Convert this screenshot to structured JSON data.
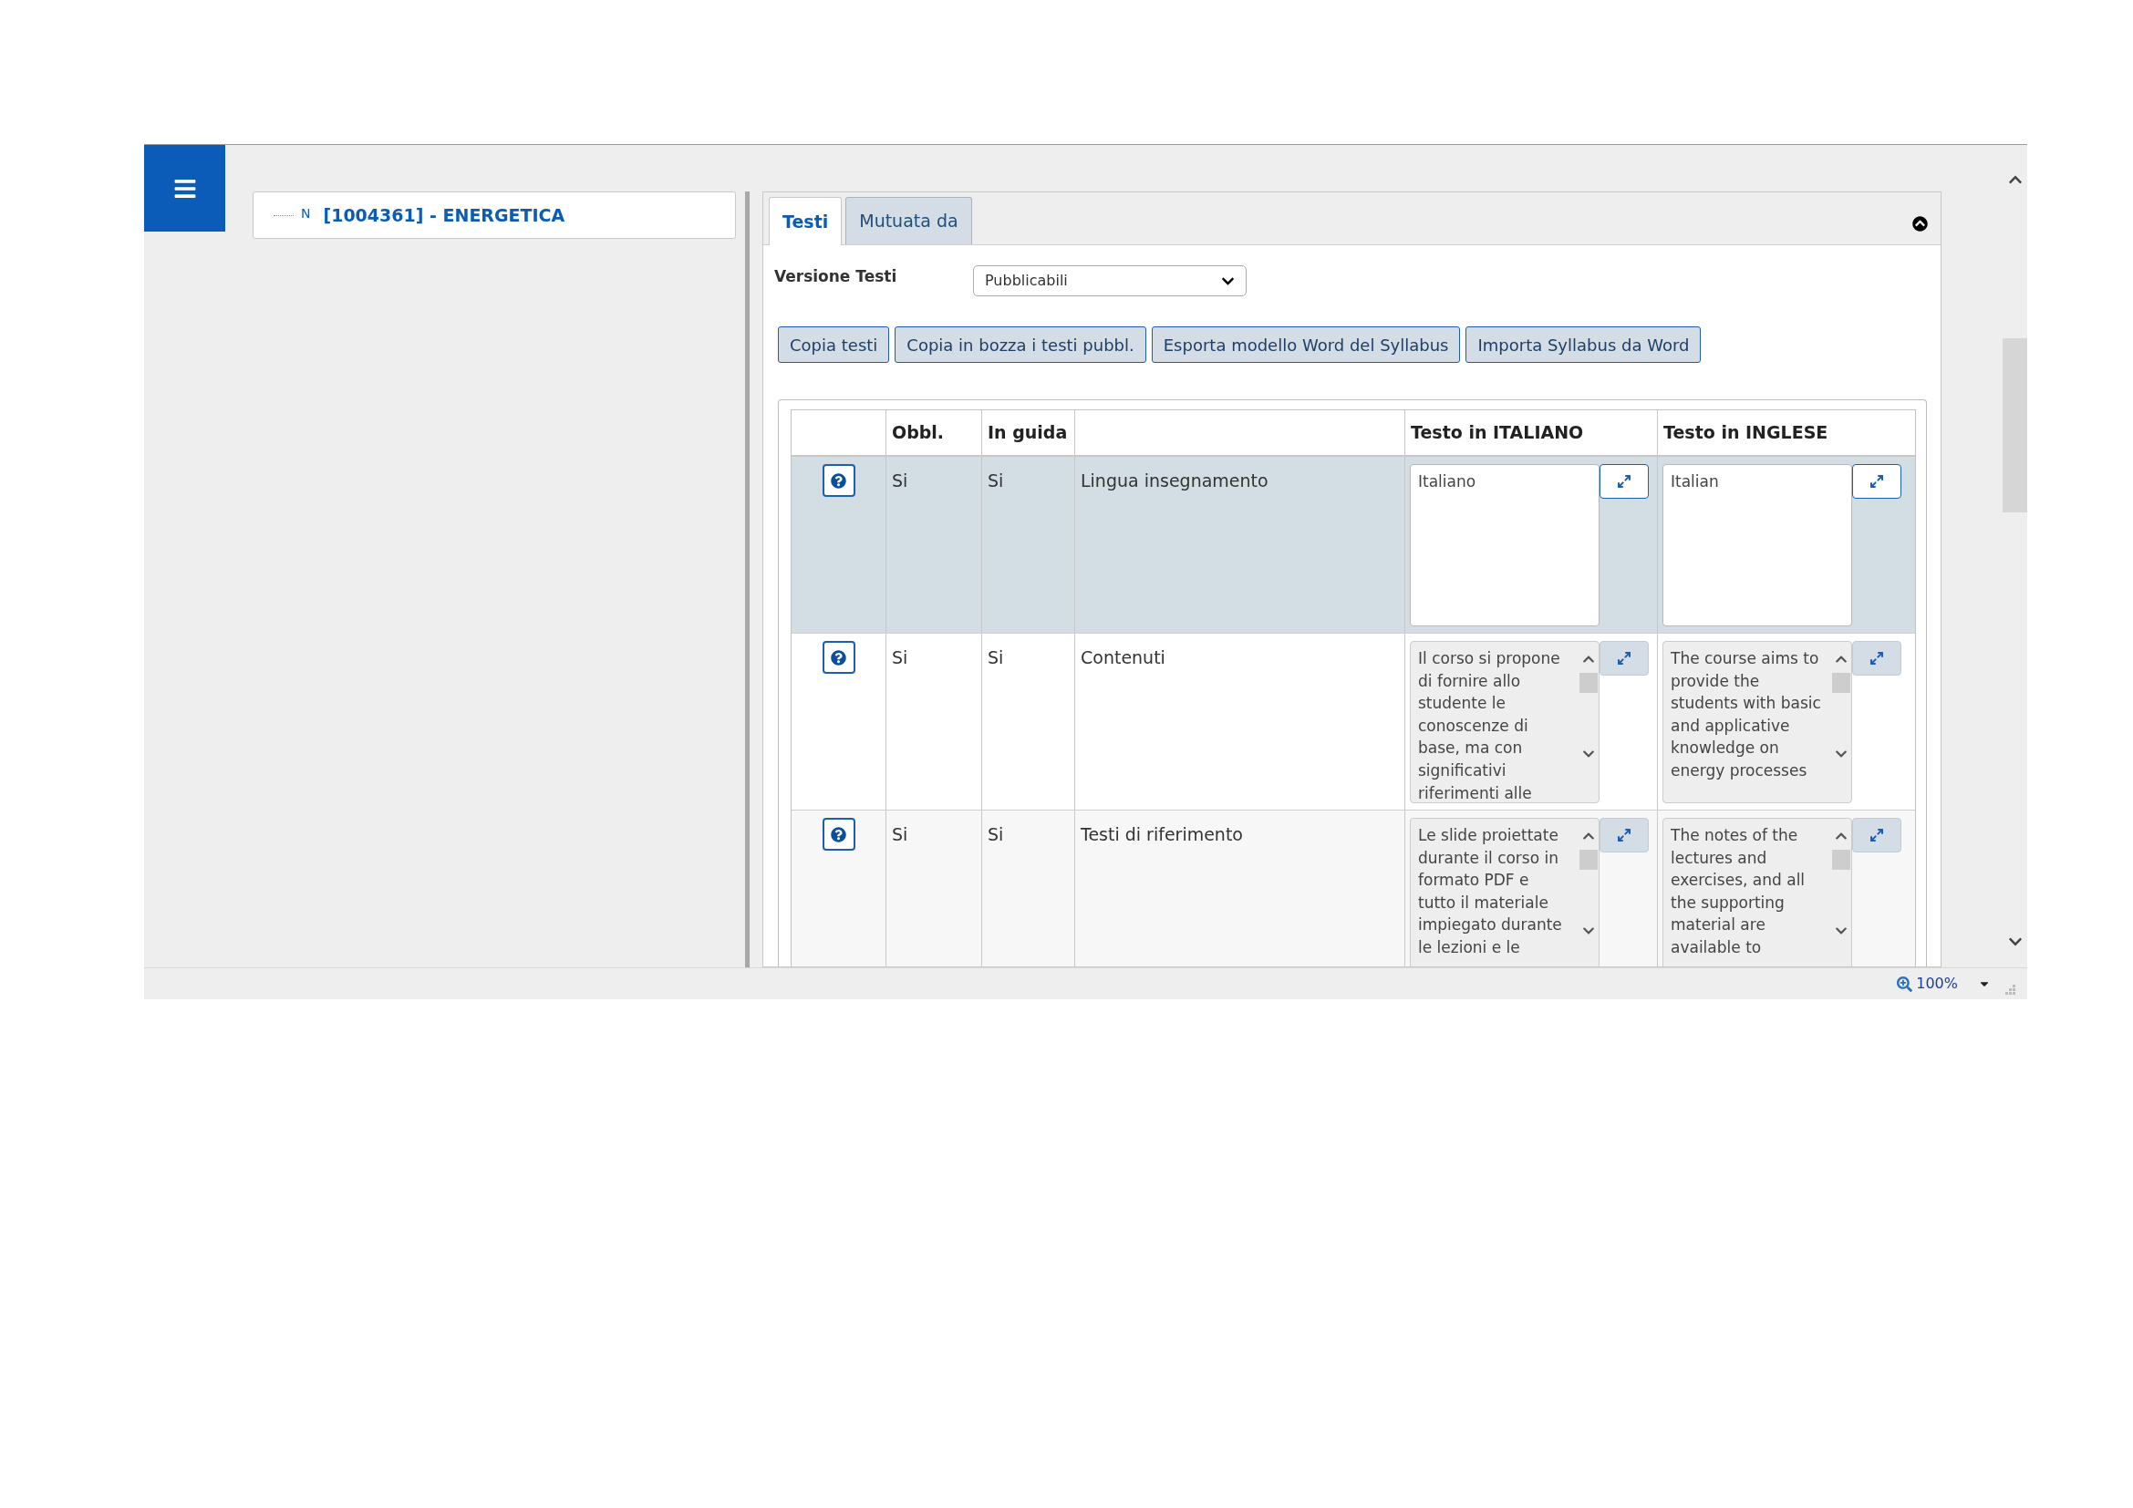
{
  "tree": {
    "prefix": "N",
    "label": "[1004361] - ENERGETICA"
  },
  "tabs": [
    {
      "label": "Testi",
      "selected": true
    },
    {
      "label": "Mutuata da",
      "selected": false
    }
  ],
  "version": {
    "label": "Versione Testi",
    "value": "Pubblicabili"
  },
  "buttons": [
    "Copia testi",
    "Copia in bozza i testi pubbl.",
    "Esporta modello Word del Syllabus",
    "Importa Syllabus da Word"
  ],
  "table": {
    "columns": [
      "Obbl.",
      "In guida",
      "Testo in ITALIANO",
      "Testo in INGLESE"
    ],
    "rows": [
      {
        "selected": true,
        "obbl": "Si",
        "in_guida": "Si",
        "field": "Lingua insegnamento",
        "italiano": "Italiano",
        "inglese": "Italian"
      },
      {
        "selected": false,
        "obbl": "Si",
        "in_guida": "Si",
        "field": "Contenuti",
        "italiano": "Il corso si propone di fornire allo studente le conoscenze di base, ma con significativi riferimenti alle",
        "inglese": "The course aims to provide the students with basic and applicative knowledge on energy processes"
      },
      {
        "selected": false,
        "obbl": "Si",
        "in_guida": "Si",
        "field": "Testi di riferimento",
        "italiano": "Le slide proiettate durante il corso in formato PDF e tutto il materiale impiegato durante le lezioni e le",
        "inglese": "The notes of the lectures and exercises, and all the supporting material are available to"
      }
    ]
  },
  "status_bar": {
    "zoom": "100%"
  }
}
